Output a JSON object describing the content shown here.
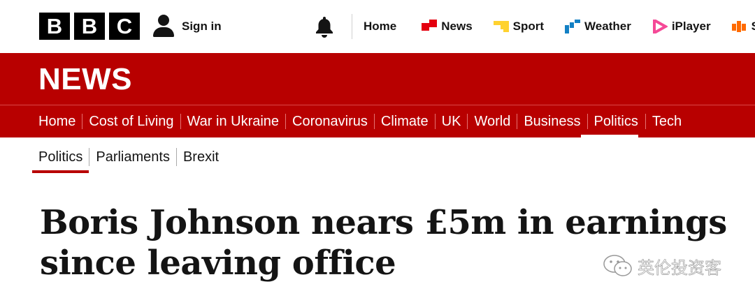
{
  "brand": {
    "logo_letters": [
      "B",
      "B",
      "C"
    ]
  },
  "header": {
    "sign_in_label": "Sign in",
    "nav": [
      {
        "label": "Home",
        "icon": "none"
      },
      {
        "label": "News",
        "icon": "news-icon",
        "color": "#e4000f"
      },
      {
        "label": "Sport",
        "icon": "sport-icon",
        "color": "#ffd230"
      },
      {
        "label": "Weather",
        "icon": "weather-icon",
        "color": "#1380c4"
      },
      {
        "label": "iPlayer",
        "icon": "iplayer-icon",
        "color": "#f54997"
      },
      {
        "label": "S",
        "icon": "sounds-icon",
        "color": "#ff6a00"
      }
    ]
  },
  "banner": {
    "title": "NEWS",
    "color": "#b80000"
  },
  "section_nav": {
    "items": [
      "Home",
      "Cost of Living",
      "War in Ukraine",
      "Coronavirus",
      "Climate",
      "UK",
      "World",
      "Business",
      "Politics",
      "Tech"
    ],
    "active": "Politics"
  },
  "sub_nav": {
    "items": [
      "Politics",
      "Parliaments",
      "Brexit"
    ],
    "active": "Politics"
  },
  "article": {
    "headline_line1": "Boris Johnson nears £5m in earnings",
    "headline_line2": "since leaving office"
  },
  "watermark": {
    "text": "英伦投资客"
  }
}
